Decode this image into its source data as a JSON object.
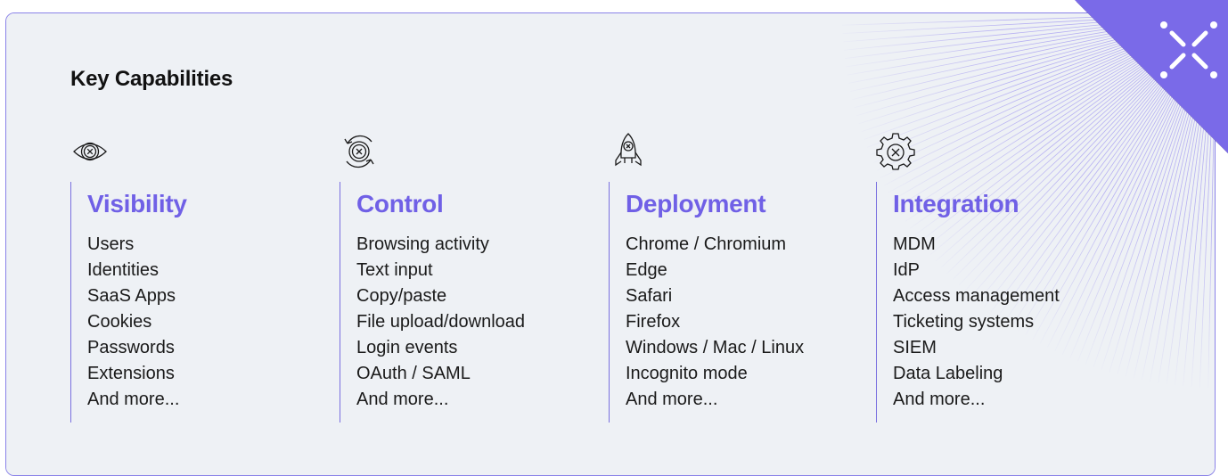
{
  "heading": "Key Capabilities",
  "colors": {
    "accent": "#7060e6",
    "card_bg": "#eef1f5",
    "card_border": "#8a82e8",
    "badge": "#7a6ae8",
    "text": "#1a1a1a"
  },
  "badge_icon": "x-logo-icon",
  "columns": [
    {
      "icon": "eye-icon",
      "title": "Visibility",
      "items": [
        "Users",
        "Identities",
        "SaaS Apps",
        "Cookies",
        "Passwords",
        "Extensions",
        "And more..."
      ]
    },
    {
      "icon": "refresh-cycle-icon",
      "title": "Control",
      "items": [
        "Browsing activity",
        "Text input",
        "Copy/paste",
        "File upload/download",
        "Login events",
        "OAuth / SAML",
        "And more..."
      ]
    },
    {
      "icon": "rocket-icon",
      "title": "Deployment",
      "items": [
        "Chrome / Chromium",
        "Edge",
        "Safari",
        "Firefox",
        "Windows / Mac / Linux",
        "Incognito mode",
        "And more..."
      ]
    },
    {
      "icon": "gear-icon",
      "title": "Integration",
      "items": [
        "MDM",
        "IdP",
        "Access management",
        "Ticketing systems",
        "SIEM",
        "Data Labeling",
        "And more..."
      ]
    }
  ]
}
